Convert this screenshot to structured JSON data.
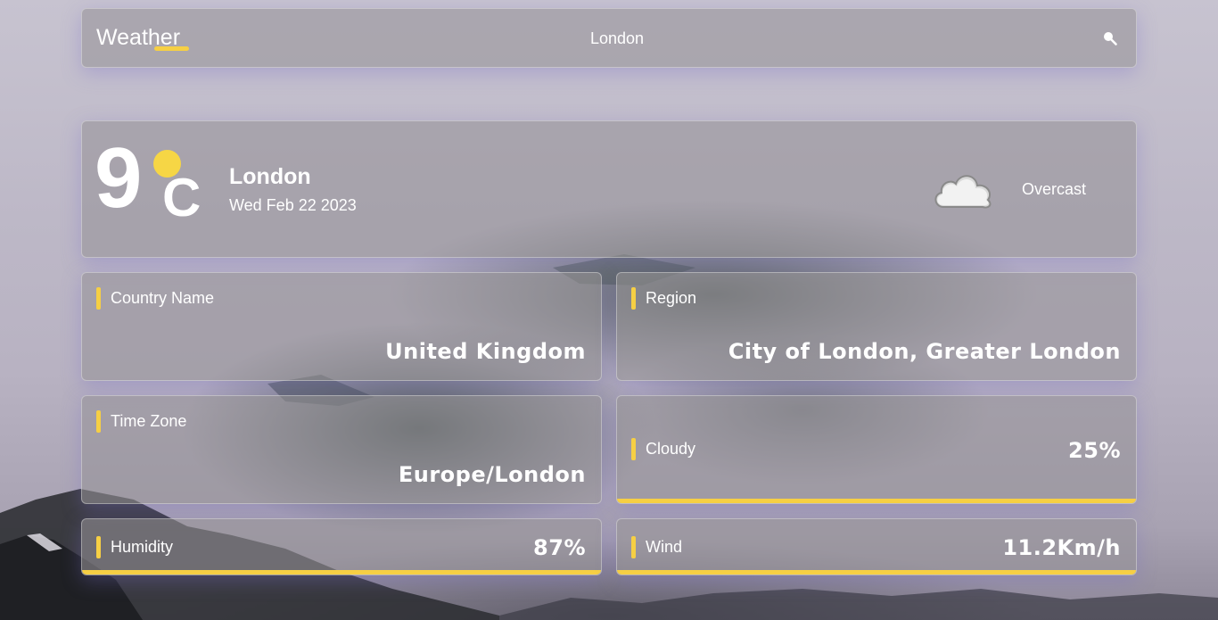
{
  "header": {
    "brand": "Weather",
    "search": {
      "value": "London",
      "placeholder": ""
    },
    "search_icon": "search-icon"
  },
  "current": {
    "temperature": "9",
    "unit": "C",
    "city": "London",
    "date": "Wed Feb 22 2023",
    "condition": "Overcast",
    "condition_icon": "cloud-icon"
  },
  "details": {
    "country": {
      "label": "Country Name",
      "value": "United Kingdom"
    },
    "region": {
      "label": "Region",
      "value": "City of London, Greater London"
    },
    "timezone": {
      "label": "Time Zone",
      "value": "Europe/London"
    },
    "cloudy": {
      "label": "Cloudy",
      "value": "25%",
      "level": 1.0
    },
    "humidity": {
      "label": "Humidity",
      "value": "87%",
      "level": 1.0
    },
    "wind": {
      "label": "Wind",
      "value": "11.2Km/h",
      "level": 1.0
    }
  },
  "colors": {
    "accent": "#f6cf44",
    "sun": "#f6d645"
  }
}
